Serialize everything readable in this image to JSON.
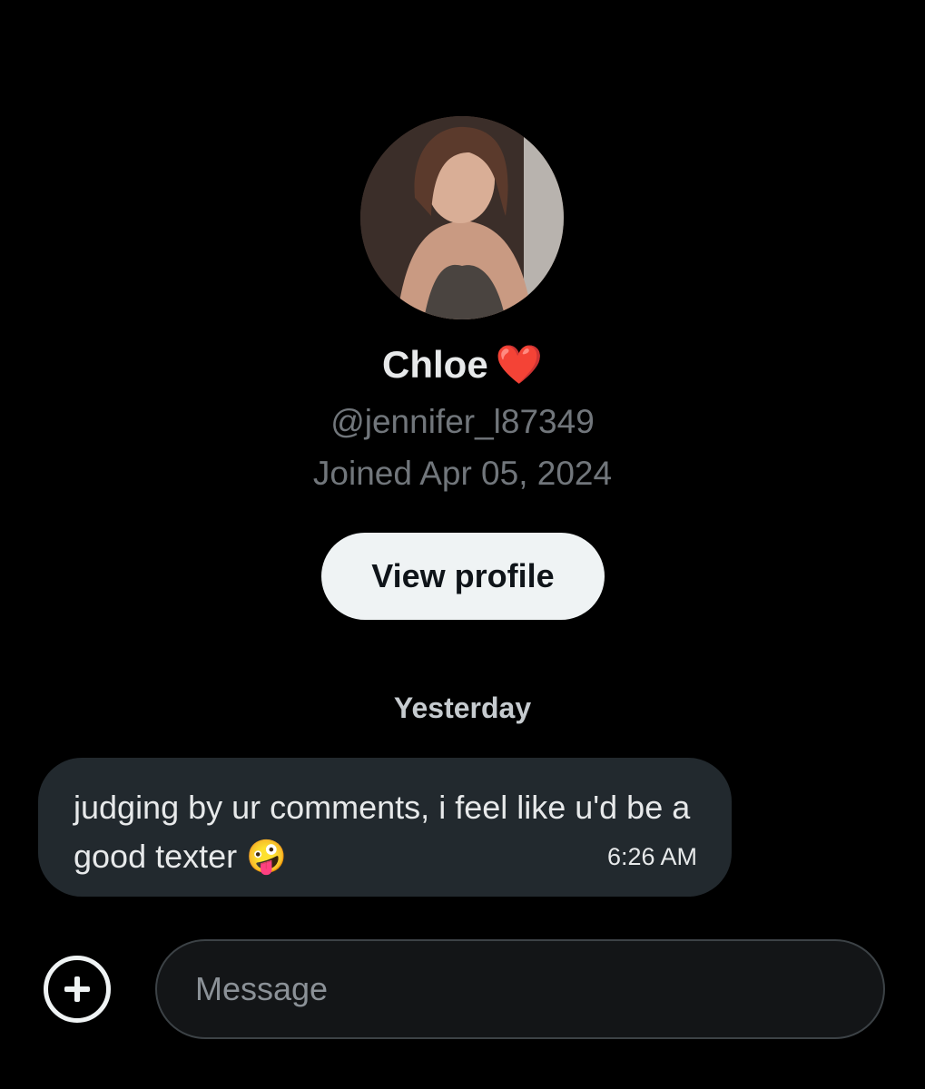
{
  "profile": {
    "display_name": "Chloe",
    "name_emoji": "❤️",
    "handle": "@jennifer_l87349",
    "joined": "Joined Apr 05, 2024",
    "view_profile_label": "View profile"
  },
  "conversation": {
    "date_separator": "Yesterday",
    "messages": [
      {
        "text": "judging by ur comments, i feel like u'd be a good texter 🤪",
        "time": "6:26 AM"
      }
    ]
  },
  "composer": {
    "placeholder": "Message",
    "add_icon": "plus-circle-icon"
  },
  "colors": {
    "background": "#000000",
    "bubble": "#22292e",
    "button": "#eff3f4",
    "secondary_text": "#71767b"
  }
}
